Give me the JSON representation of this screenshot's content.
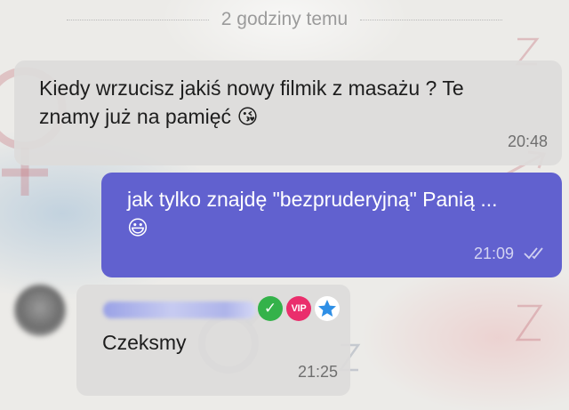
{
  "date_separator": "2 godziny temu",
  "messages": [
    {
      "direction": "incoming",
      "text_line1": "Kiedy wrzucisz jakiś nowy filmik z masażu ? Te",
      "text_line2": "znamy już na pamięć ",
      "emoji": "😘",
      "time": "20:48"
    },
    {
      "direction": "outgoing",
      "text_line1": "jak tylko znajdę \"bezpruderyjną\" Panią ...",
      "emoji": "😃",
      "time": "21:09",
      "status_icon": "double-check-read-icon"
    },
    {
      "direction": "incoming",
      "sender_badges": [
        "verified-badge-icon",
        "vip-badge-icon",
        "star-badge-icon"
      ],
      "vip_label": "VIP",
      "text": "Czeksmy",
      "time": "21:25"
    }
  ],
  "colors": {
    "incoming_bubble": "#dcdbd9",
    "outgoing_bubble": "#6161cf",
    "verified": "#34b24a",
    "vip": "#ea2e6c",
    "star": "#2e8fe6"
  }
}
